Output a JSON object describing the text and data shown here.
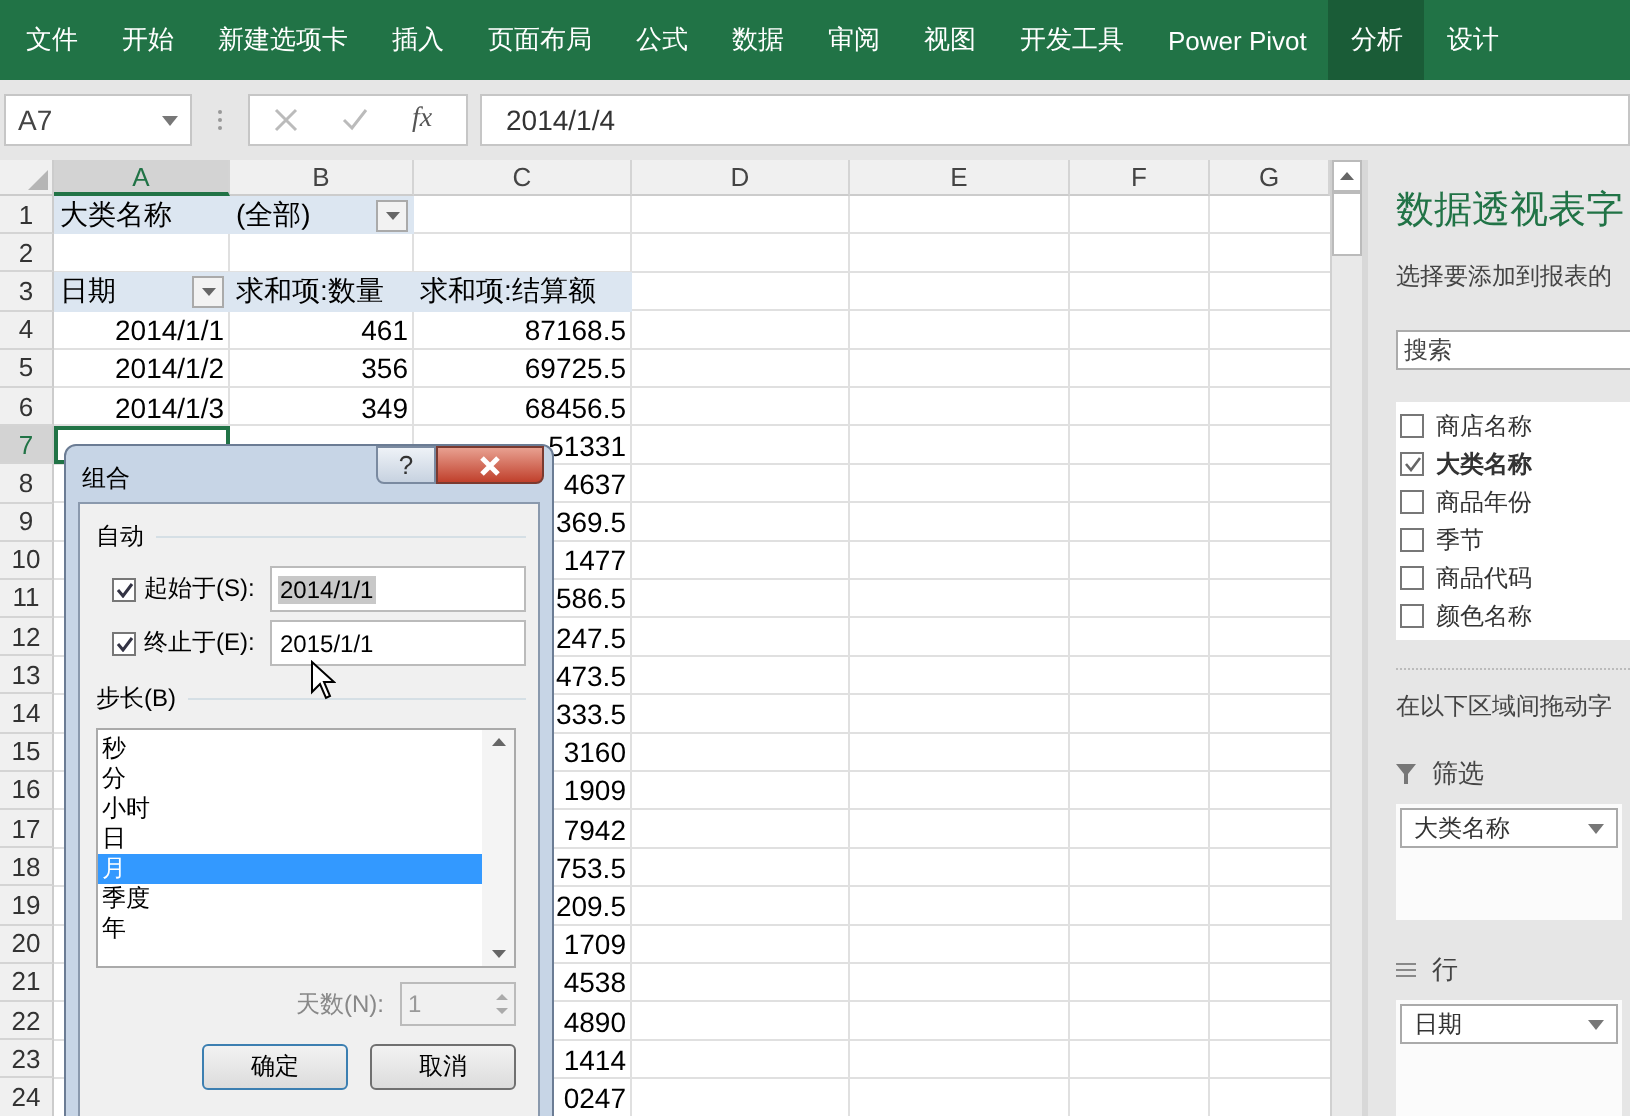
{
  "ribbon_tabs": [
    {
      "label": "文件",
      "selected": false
    },
    {
      "label": "开始",
      "selected": false
    },
    {
      "label": "新建选项卡",
      "selected": false
    },
    {
      "label": "插入",
      "selected": false
    },
    {
      "label": "页面布局",
      "selected": false
    },
    {
      "label": "公式",
      "selected": false
    },
    {
      "label": "数据",
      "selected": false
    },
    {
      "label": "审阅",
      "selected": false
    },
    {
      "label": "视图",
      "selected": false
    },
    {
      "label": "开发工具",
      "selected": false
    },
    {
      "label": "Power Pivot",
      "selected": false
    },
    {
      "label": "分析",
      "selected": true
    },
    {
      "label": "设计",
      "selected": false
    }
  ],
  "name_box": "A7",
  "function_label": "fx",
  "formula": "2014/1/4",
  "columns": [
    {
      "label": "A",
      "selected": true
    },
    {
      "label": "B",
      "selected": false
    },
    {
      "label": "C",
      "selected": false
    },
    {
      "label": "D",
      "selected": false
    },
    {
      "label": "E",
      "selected": false
    },
    {
      "label": "F",
      "selected": false
    },
    {
      "label": "G",
      "selected": false
    }
  ],
  "rows": [
    {
      "number": "1",
      "kind": "filter",
      "a": "大类名称",
      "b": "(全部)"
    },
    {
      "number": "2",
      "kind": "blank"
    },
    {
      "number": "3",
      "kind": "header",
      "a": "日期",
      "b": "求和项:数量",
      "c": "求和项:结算额"
    },
    {
      "number": "4",
      "kind": "data",
      "a": "2014/1/1",
      "b": "461",
      "c": "87168.5"
    },
    {
      "number": "5",
      "kind": "data",
      "a": "2014/1/2",
      "b": "356",
      "c": "69725.5"
    },
    {
      "number": "6",
      "kind": "data",
      "a": "2014/1/3",
      "b": "349",
      "c": "68456.5"
    },
    {
      "number": "7",
      "kind": "data",
      "selected": true,
      "c": "51331"
    },
    {
      "number": "8",
      "kind": "data",
      "c": "4637"
    },
    {
      "number": "9",
      "kind": "data",
      "c": "369.5"
    },
    {
      "number": "10",
      "kind": "data",
      "c": "1477"
    },
    {
      "number": "11",
      "kind": "data",
      "c": "586.5"
    },
    {
      "number": "12",
      "kind": "data",
      "c": "247.5"
    },
    {
      "number": "13",
      "kind": "data",
      "c": "473.5"
    },
    {
      "number": "14",
      "kind": "data",
      "c": "333.5"
    },
    {
      "number": "15",
      "kind": "data",
      "c": "3160"
    },
    {
      "number": "16",
      "kind": "data",
      "c": "1909"
    },
    {
      "number": "17",
      "kind": "data",
      "c": "7942"
    },
    {
      "number": "18",
      "kind": "data",
      "c": "753.5"
    },
    {
      "number": "19",
      "kind": "data",
      "c": "209.5"
    },
    {
      "number": "20",
      "kind": "data",
      "c": "1709"
    },
    {
      "number": "21",
      "kind": "data",
      "c": "4538"
    },
    {
      "number": "22",
      "kind": "data",
      "c": "4890"
    },
    {
      "number": "23",
      "kind": "data",
      "c": "1414"
    },
    {
      "number": "24",
      "kind": "data",
      "c": "0247"
    }
  ],
  "dialog": {
    "title": "组合",
    "help": "?",
    "auto_label": "自动",
    "start": {
      "label": "起始于(S):",
      "checked": true,
      "value": "2014/1/1"
    },
    "end": {
      "label": "终止于(E):",
      "checked": true,
      "value": "2015/1/1"
    },
    "step_label": "步长(B)",
    "step_items": [
      {
        "label": "秒",
        "selected": false
      },
      {
        "label": "分",
        "selected": false
      },
      {
        "label": "小时",
        "selected": false
      },
      {
        "label": "日",
        "selected": false
      },
      {
        "label": "月",
        "selected": true
      },
      {
        "label": "季度",
        "selected": false
      },
      {
        "label": "年",
        "selected": false
      }
    ],
    "days_label": "天数(N):",
    "days_value": "1",
    "days_disabled": true,
    "buttons": [
      "确定",
      "取消"
    ]
  },
  "panel": {
    "title": "数据透视表字",
    "subtitle": "选择要添加到报表的",
    "search": {
      "placeholder": "搜索"
    },
    "fields": [
      {
        "label": "商店名称",
        "checked": false
      },
      {
        "label": "大类名称",
        "checked": true
      },
      {
        "label": "商品年份",
        "checked": false
      },
      {
        "label": "季节",
        "checked": false
      },
      {
        "label": "商品代码",
        "checked": false
      },
      {
        "label": "颜色名称",
        "checked": false
      }
    ],
    "areas_hint": "在以下区域间拖动字",
    "areas": [
      {
        "kind": "filter",
        "label": "筛选",
        "items": [
          "大类名称"
        ]
      },
      {
        "kind": "rows",
        "label": "行",
        "items": [
          "日期"
        ]
      }
    ]
  }
}
